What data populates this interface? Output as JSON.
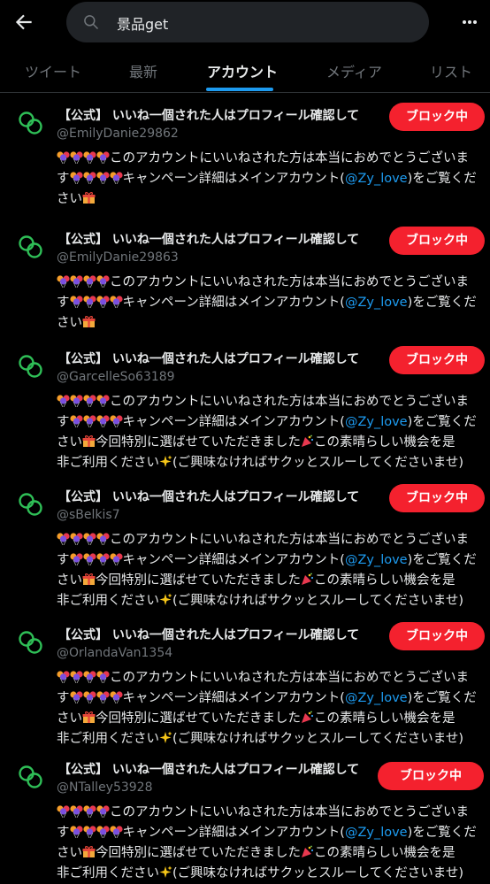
{
  "header": {
    "search_query": "景品get"
  },
  "tabs": [
    {
      "label": "ツイート"
    },
    {
      "label": "最新"
    },
    {
      "label": "アカウント"
    },
    {
      "label": "メディア"
    },
    {
      "label": "リスト"
    }
  ],
  "accounts": [
    {
      "name": "【公式】 いいね一個された人はプロフィール確認して",
      "handle": "@EmilyDanie29862",
      "button": "ブロック中"
    },
    {
      "name": "【公式】 いいね一個された人はプロフィール確認して",
      "handle": "@EmilyDanie29863",
      "button": "ブロック中"
    },
    {
      "name": "【公式】 いいね一個された人はプロフィール確認して",
      "handle": "@GarcelleSo63189",
      "button": "ブロック中"
    },
    {
      "name": "【公式】 いいね一個された人はプロフィール確認して",
      "handle": "@sBelkis7",
      "button": "ブロック中"
    },
    {
      "name": "【公式】 いいね一個された人はプロフィール確認して",
      "handle": "@OrlandaVan1354",
      "button": "ブロック中"
    },
    {
      "name": "【公式】 いいね一個された人はプロフィール確認して",
      "handle": "@NTalley53928",
      "button": "ブロック中"
    }
  ],
  "bio": {
    "line1": "このアカウントにいいねされた方は本当におめでとうございま",
    "line2_start": "す",
    "line2_mid": "キャンペーン詳細はメインアカウント(",
    "mention": "@Zy_love",
    "line2_end": ")をご覧くだ",
    "line3_short": "さい",
    "line3_start": "さい",
    "line3_mid": "今回特別に選ばせていただきました",
    "line3_end": "この素晴らしい機会を是",
    "line4_start": "非ご利用ください",
    "line4_end": "(ご興味なければサクッとスルーしてくださいませ)"
  },
  "colors": {
    "block": "#f4212e",
    "link": "#1d9bf0",
    "avatar_ring": "#2fbf57"
  }
}
